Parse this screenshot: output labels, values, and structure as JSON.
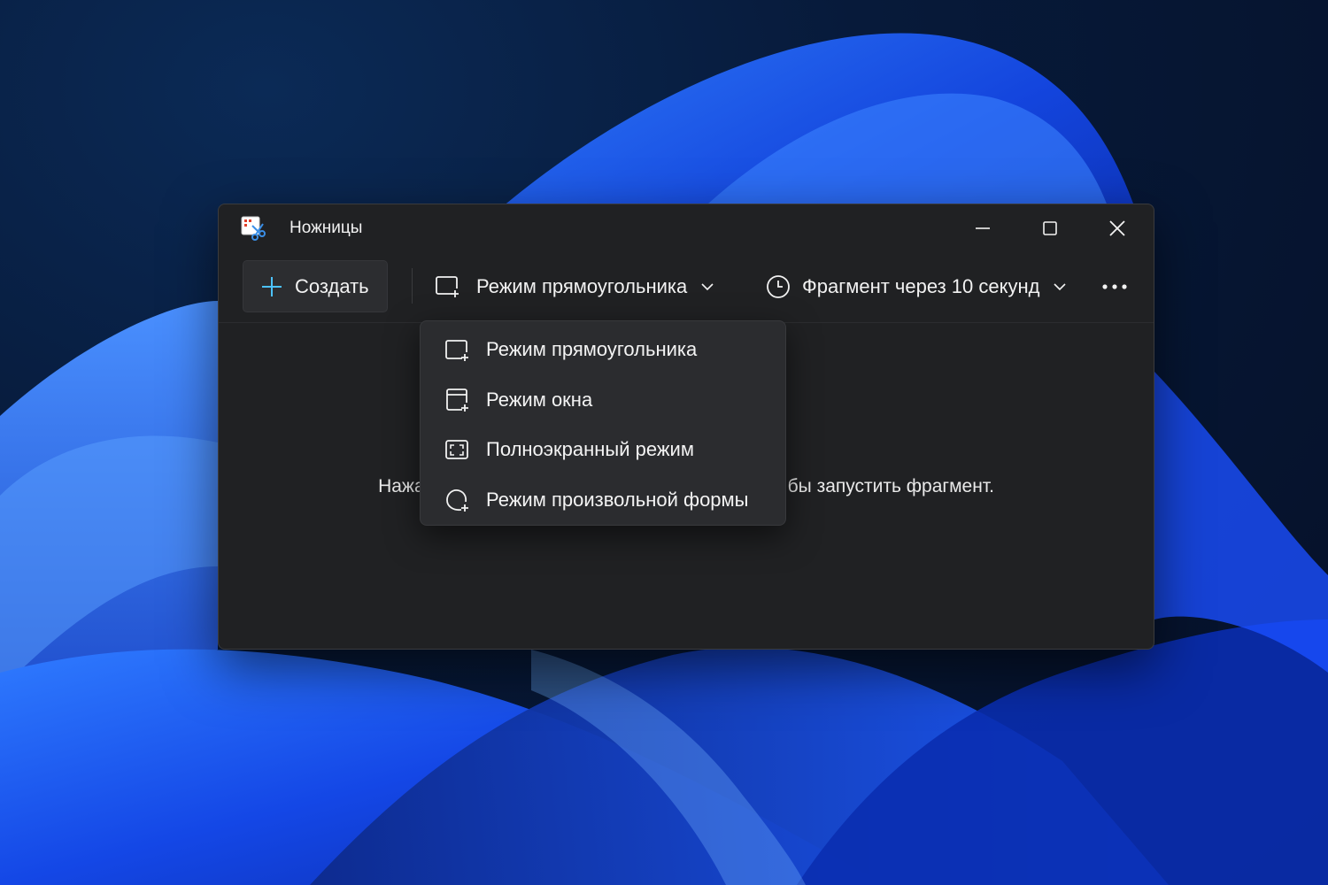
{
  "window": {
    "title": "Ножницы",
    "app_icon": "snipping-tool-icon"
  },
  "caption_buttons": {
    "minimize_icon": "minimize-icon",
    "maximize_icon": "maximize-icon",
    "close_icon": "close-icon"
  },
  "toolbar": {
    "create_label": "Создать",
    "mode_label": "Режим прямоугольника",
    "delay_label": "Фрагмент через 10 секунд",
    "more_icon": "more-icon"
  },
  "main": {
    "hint_left": "Нажа",
    "hint_right": "бы запустить фрагмент."
  },
  "mode_menu": {
    "items": [
      {
        "label": "Режим прямоугольника",
        "icon": "rectangle-snip-icon"
      },
      {
        "label": "Режим окна",
        "icon": "window-snip-icon"
      },
      {
        "label": "Полноэкранный режим",
        "icon": "fullscreen-snip-icon"
      },
      {
        "label": "Режим произвольной формы",
        "icon": "freeform-snip-icon"
      }
    ]
  },
  "colors": {
    "window_bg": "#202123",
    "menu_bg": "#2b2c2f",
    "accent": "#4cc2ff",
    "wallpaper_blue": "#1a4bff"
  }
}
